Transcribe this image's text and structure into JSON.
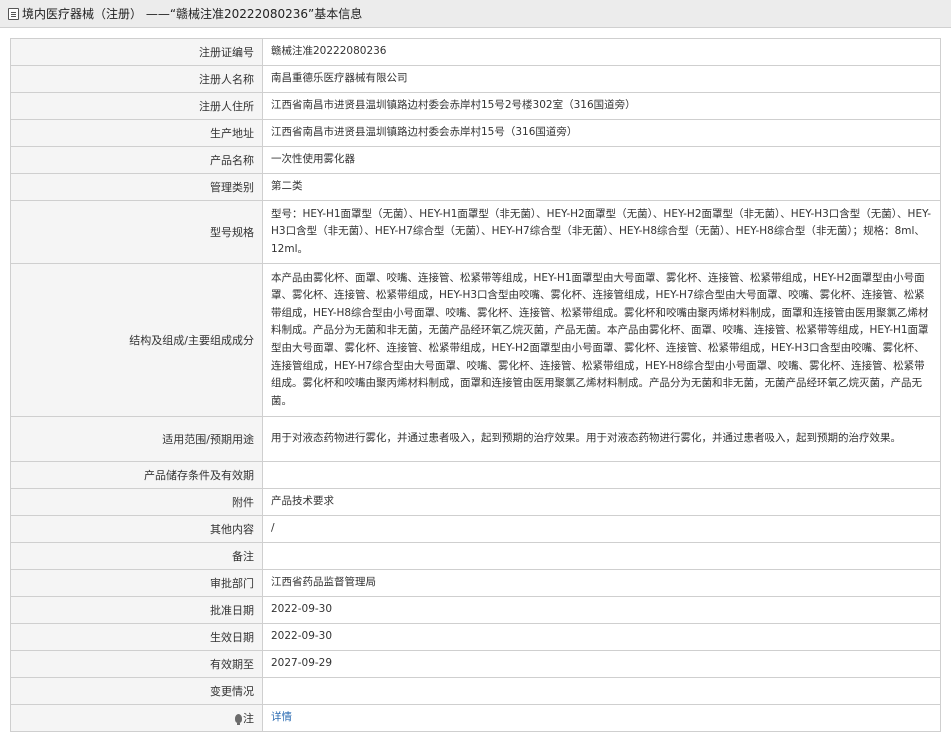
{
  "header": {
    "title": "境内医疗器械（注册） ——“赣械注准20222080236”基本信息",
    "icon": "document-icon"
  },
  "rows": [
    {
      "label": "注册证编号",
      "value": "赣械注准20222080236"
    },
    {
      "label": "注册人名称",
      "value": "南昌重德乐医疗器械有限公司"
    },
    {
      "label": "注册人住所",
      "value": "江西省南昌市进贤县温圳镇路边村委会赤岸村15号2号楼302室（316国道旁）"
    },
    {
      "label": "生产地址",
      "value": "江西省南昌市进贤县温圳镇路边村委会赤岸村15号（316国道旁）"
    },
    {
      "label": "产品名称",
      "value": "一次性使用雾化器"
    },
    {
      "label": "管理类别",
      "value": "第二类"
    },
    {
      "label": "型号规格",
      "value": "型号：HEY-H1面罩型（无菌）、HEY-H1面罩型（非无菌）、HEY-H2面罩型（无菌）、HEY-H2面罩型（非无菌）、HEY-H3口含型（无菌）、HEY-H3口含型（非无菌）、HEY-H7综合型（无菌）、HEY-H7综合型（非无菌）、HEY-H8综合型（无菌）、HEY-H8综合型（非无菌）；规格：8ml、12ml。"
    },
    {
      "label": "结构及组成/主要组成成分",
      "value": "本产品由雾化杯、面罩、咬嘴、连接管、松紧带等组成，HEY-H1面罩型由大号面罩、雾化杯、连接管、松紧带组成，HEY-H2面罩型由小号面罩、雾化杯、连接管、松紧带组成，HEY-H3口含型由咬嘴、雾化杯、连接管组成，HEY-H7综合型由大号面罩、咬嘴、雾化杯、连接管、松紧带组成，HEY-H8综合型由小号面罩、咬嘴、雾化杯、连接管、松紧带组成。雾化杯和咬嘴由聚丙烯材料制成，面罩和连接管由医用聚氯乙烯材料制成。产品分为无菌和非无菌，无菌产品经环氧乙烷灭菌，产品无菌。本产品由雾化杯、面罩、咬嘴、连接管、松紧带等组成，HEY-H1面罩型由大号面罩、雾化杯、连接管、松紧带组成，HEY-H2面罩型由小号面罩、雾化杯、连接管、松紧带组成，HEY-H3口含型由咬嘴、雾化杯、连接管组成，HEY-H7综合型由大号面罩、咬嘴、雾化杯、连接管、松紧带组成，HEY-H8综合型由小号面罩、咬嘴、雾化杯、连接管、松紧带组成。雾化杯和咬嘴由聚丙烯材料制成，面罩和连接管由医用聚氯乙烯材料制成。产品分为无菌和非无菌，无菌产品经环氧乙烷灭菌，产品无菌。"
    },
    {
      "label": "适用范围/预期用途",
      "value": "用于对液态药物进行雾化，并通过患者吸入，起到预期的治疗效果。用于对液态药物进行雾化，并通过患者吸入，起到预期的治疗效果。"
    },
    {
      "label": "产品储存条件及有效期",
      "value": ""
    },
    {
      "label": "附件",
      "value": "产品技术要求"
    },
    {
      "label": "其他内容",
      "value": "/"
    },
    {
      "label": "备注",
      "value": ""
    },
    {
      "label": "审批部门",
      "value": "江西省药品监督管理局"
    },
    {
      "label": "批准日期",
      "value": "2022-09-30"
    },
    {
      "label": "生效日期",
      "value": "2022-09-30"
    },
    {
      "label": "有效期至",
      "value": "2027-09-29"
    },
    {
      "label": "变更情况",
      "value": ""
    }
  ],
  "note_row": {
    "label": "注",
    "icon": "lightbulb-icon",
    "link": "详情"
  }
}
